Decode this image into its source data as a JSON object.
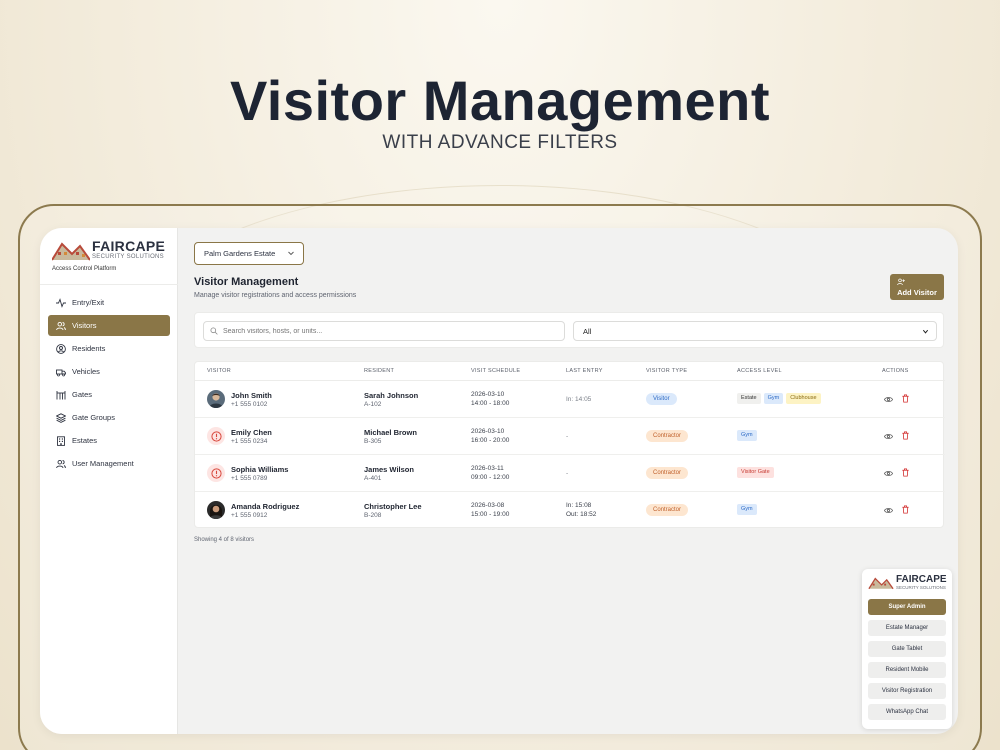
{
  "hero": {
    "title": "Visitor Management",
    "subtitle": "WITH ADVANCE FILTERS"
  },
  "brand": {
    "name": "FAIRCAPE",
    "sub": "SECURITY SOLUTIONS",
    "tagline": "Access Control Platform"
  },
  "nav": [
    {
      "label": "Entry/Exit",
      "icon": "activity-icon",
      "active": false
    },
    {
      "label": "Visitors",
      "icon": "users-icon",
      "active": true
    },
    {
      "label": "Residents",
      "icon": "user-circle-icon",
      "active": false
    },
    {
      "label": "Vehicles",
      "icon": "truck-icon",
      "active": false
    },
    {
      "label": "Gates",
      "icon": "gate-icon",
      "active": false
    },
    {
      "label": "Gate Groups",
      "icon": "layers-icon",
      "active": false
    },
    {
      "label": "Estates",
      "icon": "building-icon",
      "active": false
    },
    {
      "label": "User Management",
      "icon": "user-cog-icon",
      "active": false
    }
  ],
  "estate_select": {
    "value": "Palm Gardens Estate"
  },
  "page": {
    "title": "Visitor Management",
    "subtitle": "Manage visitor registrations and access permissions",
    "add_label": "Add Visitor"
  },
  "filters": {
    "search_placeholder": "Search visitors, hosts, or units...",
    "type_value": "All"
  },
  "table": {
    "headers": [
      "VISITOR",
      "RESIDENT",
      "VISIT SCHEDULE",
      "LAST ENTRY",
      "VISITOR TYPE",
      "ACCESS LEVEL",
      "ACTIONS"
    ],
    "rows": [
      {
        "name": "John Smith",
        "phone": "+1 555 0102",
        "resident": "Sarah Johnson",
        "unit": "A-102",
        "date": "2026-03-10",
        "time": "14:00 - 18:00",
        "entry1": "In: 14:05",
        "entry2": "",
        "type": "Visitor",
        "tags": [
          "Estate",
          "Gym",
          "Clubhouse"
        ]
      },
      {
        "name": "Emily Chen",
        "phone": "+1 555 0234",
        "resident": "Michael Brown",
        "unit": "B-305",
        "date": "2026-03-10",
        "time": "16:00 - 20:00",
        "entry1": "-",
        "entry2": "",
        "type": "Contractor",
        "tags": [
          "Gym"
        ]
      },
      {
        "name": "Sophia Williams",
        "phone": "+1 555 0789",
        "resident": "James Wilson",
        "unit": "A-401",
        "date": "2026-03-11",
        "time": "09:00 - 12:00",
        "entry1": "-",
        "entry2": "",
        "type": "Contractor",
        "tags": [
          "Visitor Gate"
        ]
      },
      {
        "name": "Amanda Rodriguez",
        "phone": "+1 555 0912",
        "resident": "Christopher Lee",
        "unit": "B-208",
        "date": "2026-03-08",
        "time": "15:00 - 19:00",
        "entry1": "In: 15:08",
        "entry2": "Out: 18:52",
        "type": "Contractor",
        "tags": [
          "Gym"
        ]
      }
    ],
    "footer": "Showing 4 of 8 visitors"
  },
  "roles": {
    "brand": {
      "name": "FAIRCAPE",
      "sub": "SECURITY SOLUTIONS"
    },
    "items": [
      "Super Admin",
      "Estate Manager",
      "Gate Tablet",
      "Resident Mobile",
      "Visitor Registration",
      "WhatsApp Chat"
    ],
    "active": "Super Admin"
  },
  "colors": {
    "accent": "#8a7647",
    "frame": "#8c7a4e"
  }
}
